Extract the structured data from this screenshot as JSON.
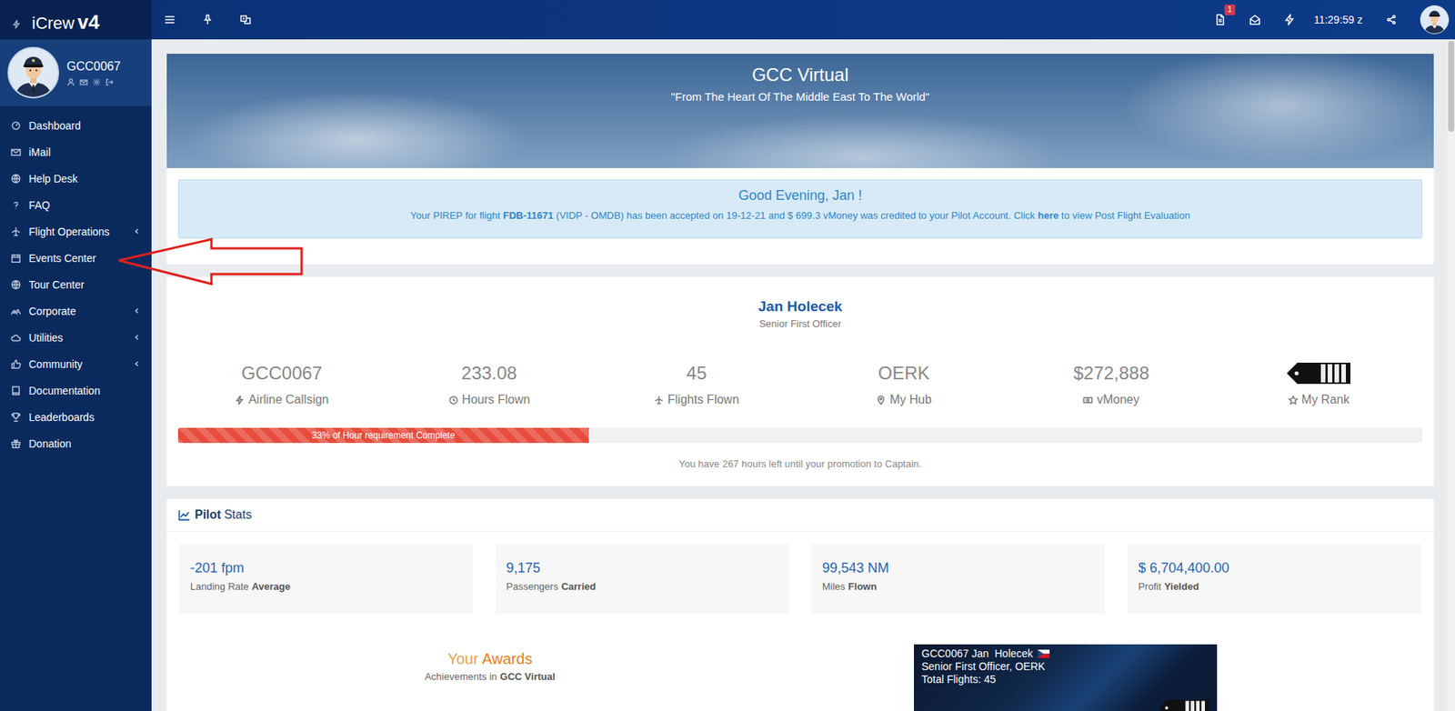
{
  "brand": {
    "name": "iCrew",
    "version": "v4"
  },
  "user": {
    "callsign": "GCC0067"
  },
  "sidebar": {
    "items": [
      {
        "label": "Dashboard",
        "expandable": false
      },
      {
        "label": "iMail",
        "expandable": false
      },
      {
        "label": "Help Desk",
        "expandable": false
      },
      {
        "label": "FAQ",
        "expandable": false
      },
      {
        "label": "Flight Operations",
        "expandable": true
      },
      {
        "label": "Events Center",
        "expandable": false
      },
      {
        "label": "Tour Center",
        "expandable": false
      },
      {
        "label": "Corporate",
        "expandable": true
      },
      {
        "label": "Utilities",
        "expandable": true
      },
      {
        "label": "Community",
        "expandable": true
      },
      {
        "label": "Documentation",
        "expandable": false
      },
      {
        "label": "Leaderboards",
        "expandable": false
      },
      {
        "label": "Donation",
        "expandable": false
      }
    ]
  },
  "topbar": {
    "notification_count": "1",
    "clock": "11:29:59 z"
  },
  "banner": {
    "title": "GCC Virtual",
    "tagline": "\"From The Heart Of The Middle East To The World\""
  },
  "alert": {
    "greeting": "Good Evening, Jan !",
    "message": [
      {
        "text": "Your PIREP for flight ",
        "bold": false
      },
      {
        "text": "FDB-11671",
        "bold": true
      },
      {
        "text": " (VIDP - OMDB) has been accepted on 19-12-21 and $ 699.3 vMoney was credited to your Pilot Account. Click ",
        "bold": false
      },
      {
        "text": "here",
        "bold": true
      },
      {
        "text": " to view Post Flight Evaluation",
        "bold": false
      }
    ]
  },
  "profile": {
    "name": "Jan Holecek",
    "rank": "Senior First Officer",
    "stats": [
      {
        "kind": "text",
        "value": "GCC0067",
        "label": "Airline Callsign"
      },
      {
        "kind": "text",
        "value": "233.08",
        "label": "Hours Flown"
      },
      {
        "kind": "text",
        "value": "45",
        "label": "Flights Flown"
      },
      {
        "kind": "text",
        "value": "OERK",
        "label": "My Hub"
      },
      {
        "kind": "text",
        "value": "$272,888",
        "label": "vMoney"
      },
      {
        "kind": "badge",
        "label": "My Rank"
      }
    ]
  },
  "progress": {
    "level": 0.33,
    "label": "33% of Hour requirement Complete",
    "note": "You have 267 hours left until your promotion to Captain."
  },
  "pilot_stats": {
    "title_bold": "Pilot",
    "title": "Stats",
    "items": [
      {
        "value": "-201 fpm",
        "label": "Landing Rate",
        "label_bold": "Average"
      },
      {
        "value": "9,175",
        "label": "Passengers",
        "label_bold": "Carried"
      },
      {
        "value": "99,543 NM",
        "label": "Miles",
        "label_bold": "Flown"
      },
      {
        "value": "$ 6,704,400.00",
        "label": "Profit",
        "label_bold": "Yielded"
      }
    ]
  },
  "awards": {
    "title_first": "Your",
    "title_second": "Awards",
    "subtitle": "Achievements in",
    "subtitle_bold": "GCC Virtual"
  },
  "signature": {
    "lines": [
      "GCC0067 Jan  Holecek",
      "Senior First Officer, OERK",
      "Total Flights: 45"
    ]
  }
}
